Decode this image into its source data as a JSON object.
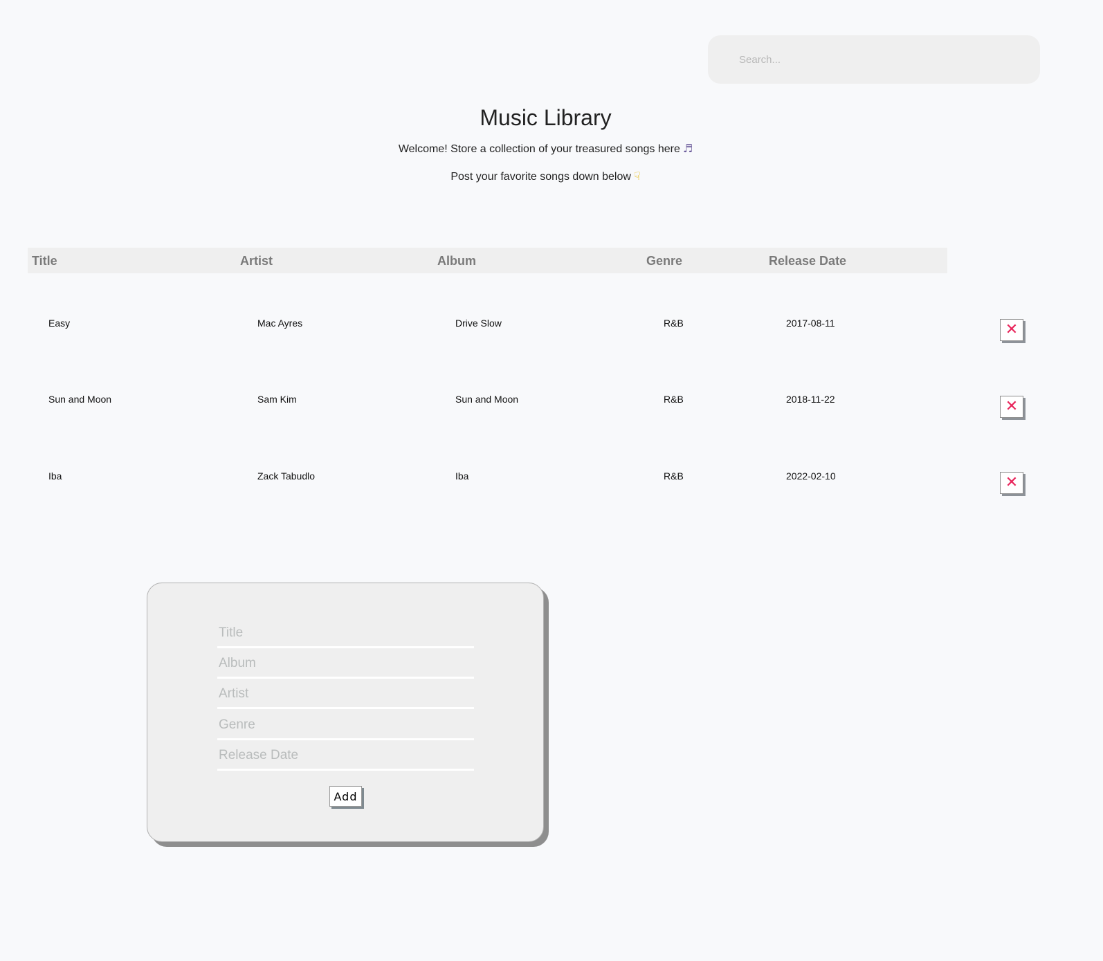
{
  "search": {
    "placeholder": "Search..."
  },
  "header": {
    "title": "Music Library",
    "welcome": "Welcome! Store a collection of your treasured songs here",
    "prompt": "Post your favorite songs down below"
  },
  "icons": {
    "welcome_icon": "music-note-icon",
    "prompt_icon": "pointing-down-hand-icon",
    "delete_icon": "close-x-icon"
  },
  "colors": {
    "delete_accent": "#e8245a",
    "header_bg": "#efefef",
    "page_bg": "#f8f9fb"
  },
  "table": {
    "columns": [
      "Title",
      "Artist",
      "Album",
      "Genre",
      "Release Date"
    ],
    "rows": [
      {
        "title": "Easy",
        "artist": "Mac Ayres",
        "album": "Drive Slow",
        "genre": "R&B",
        "release_date": "2017-08-11"
      },
      {
        "title": "Sun and Moon",
        "artist": "Sam Kim",
        "album": "Sun and Moon",
        "genre": "R&B",
        "release_date": "2018-11-22"
      },
      {
        "title": "Iba",
        "artist": "Zack Tabudlo",
        "album": "Iba",
        "genre": "R&B",
        "release_date": "2022-02-10"
      }
    ],
    "delete_label": "✕"
  },
  "form": {
    "title_placeholder": "Title",
    "album_placeholder": "Album",
    "artist_placeholder": "Artist",
    "genre_placeholder": "Genre",
    "release_date_placeholder": "Release Date",
    "add_label": "Add"
  }
}
